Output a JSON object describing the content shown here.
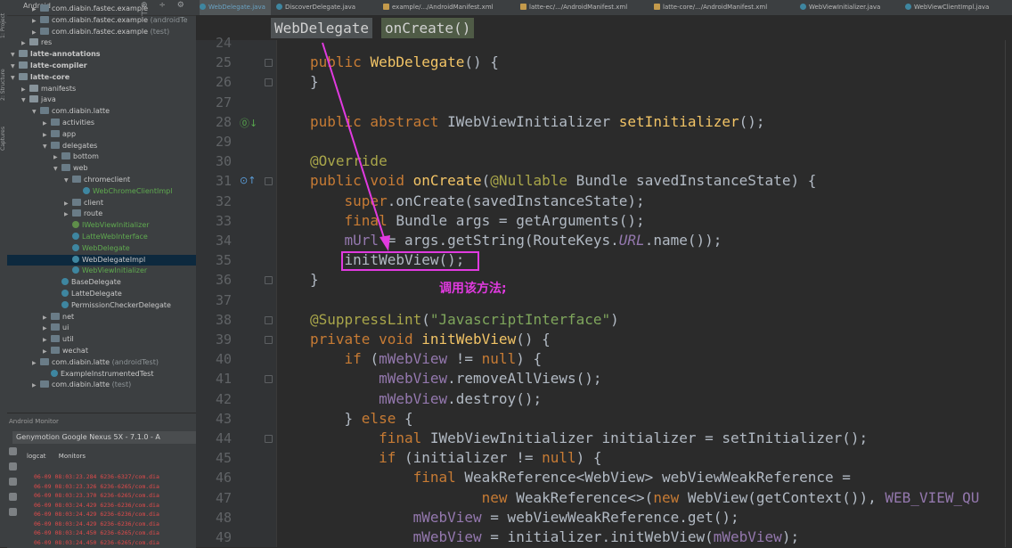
{
  "colors": {
    "accent": "#e13ae0",
    "editor_bg": "#2b2b2b",
    "panel_bg": "#3c3f41",
    "keyword": "#c77b34"
  },
  "side_strip": [
    "1: Project",
    "2: Structure",
    "Captures"
  ],
  "project_panel": {
    "selector": "Android",
    "items": [
      {
        "indent": 2,
        "icon": "pkg",
        "label": "com.diabin.fastec.example",
        "suffix": ""
      },
      {
        "indent": 2,
        "icon": "pkg",
        "label": "com.diabin.fastec.example",
        "suffix": " (androidTe"
      },
      {
        "indent": 2,
        "icon": "pkg",
        "label": "com.diabin.fastec.example",
        "suffix": " (test)"
      },
      {
        "indent": 1,
        "icon": "folder",
        "label": "res",
        "suffix": ""
      },
      {
        "indent": 0,
        "icon": "mod",
        "label": "latte-annotations",
        "suffix": ""
      },
      {
        "indent": 0,
        "icon": "mod",
        "label": "latte-compiler",
        "suffix": ""
      },
      {
        "indent": 0,
        "icon": "mod",
        "label": "latte-core",
        "suffix": ""
      },
      {
        "indent": 1,
        "icon": "folder",
        "label": "manifests",
        "suffix": ""
      },
      {
        "indent": 1,
        "icon": "folder",
        "label": "java",
        "suffix": ""
      },
      {
        "indent": 2,
        "icon": "pkg",
        "label": "com.diabin.latte",
        "suffix": ""
      },
      {
        "indent": 3,
        "icon": "pkg",
        "label": "activities",
        "suffix": ""
      },
      {
        "indent": 3,
        "icon": "pkg",
        "label": "app",
        "suffix": ""
      },
      {
        "indent": 3,
        "icon": "pkg",
        "label": "delegates",
        "suffix": ""
      },
      {
        "indent": 4,
        "icon": "pkg",
        "label": "bottom",
        "suffix": ""
      },
      {
        "indent": 4,
        "icon": "pkg",
        "label": "web",
        "suffix": ""
      },
      {
        "indent": 5,
        "icon": "pkg",
        "label": "chromeclient",
        "suffix": ""
      },
      {
        "indent": 6,
        "icon": "cls-green",
        "label": "WebChromeClientImpl",
        "suffix": ""
      },
      {
        "indent": 5,
        "icon": "pkg",
        "label": "client",
        "suffix": ""
      },
      {
        "indent": 5,
        "icon": "pkg",
        "label": "route",
        "suffix": ""
      },
      {
        "indent": 5,
        "icon": "iface-green",
        "label": "IWebViewInitializer",
        "suffix": ""
      },
      {
        "indent": 5,
        "icon": "cls-green",
        "label": "LatteWebInterface",
        "suffix": ""
      },
      {
        "indent": 5,
        "icon": "cls-green",
        "label": "WebDelegate",
        "suffix": ""
      },
      {
        "indent": 5,
        "icon": "cls",
        "label": "WebDelegateImpl",
        "suffix": ""
      },
      {
        "indent": 5,
        "icon": "cls-green",
        "label": "WebViewInitializer",
        "suffix": ""
      },
      {
        "indent": 4,
        "icon": "cls",
        "label": "BaseDelegate",
        "suffix": ""
      },
      {
        "indent": 4,
        "icon": "cls",
        "label": "LatteDelegate",
        "suffix": ""
      },
      {
        "indent": 4,
        "icon": "cls",
        "label": "PermissionCheckerDelegate",
        "suffix": ""
      },
      {
        "indent": 3,
        "icon": "pkg",
        "label": "net",
        "suffix": ""
      },
      {
        "indent": 3,
        "icon": "pkg",
        "label": "ui",
        "suffix": ""
      },
      {
        "indent": 3,
        "icon": "pkg",
        "label": "util",
        "suffix": ""
      },
      {
        "indent": 3,
        "icon": "pkg",
        "label": "wechat",
        "suffix": ""
      },
      {
        "indent": 2,
        "icon": "pkg",
        "label": "com.diabin.latte",
        "suffix": " (androidTest)"
      },
      {
        "indent": 3,
        "icon": "cls",
        "label": "ExampleInstrumentedTest",
        "suffix": ""
      },
      {
        "indent": 2,
        "icon": "pkg",
        "label": "com.diabin.latte",
        "suffix": " (test)"
      }
    ]
  },
  "android_monitor": {
    "title": "Android Monitor",
    "device": "Genymotion Google Nexus 5X - 7.1.0 - A",
    "tabs": [
      "logcat",
      "Monitors"
    ],
    "log_lines": [
      "06-09 08:03:23.284 6236-6327/com.dia",
      "06-09 08:03:23.326 6236-6265/com.dia",
      "06-09 08:03:23.370 6236-6265/com.dia",
      "06-09 08:03:24.429 6236-6236/com.dia",
      "06-09 08:03:24.429 6236-6236/com.dia",
      "06-09 08:03:24.429 6236-6236/com.dia",
      "06-09 08:03:24.450 6236-6265/com.dia",
      "06-09 08:03:24.450 6236-6265/com.dia",
      "06-09 08:03:24.699 6236-6241/com.dia"
    ]
  },
  "editor_tabs": [
    "WebDelegate.java",
    "DiscoverDelegate.java",
    "example/.../AndroidManifest.xml",
    "latte-ec/.../AndroidManifest.xml",
    "latte-core/.../AndroidManifest.xml",
    "WebViewInitializer.java",
    "WebViewClientImpl.java"
  ],
  "breadcrumb": [
    "WebDelegate",
    "onCreate()"
  ],
  "line_numbers": [
    "24",
    "25",
    "26",
    "27",
    "28",
    "29",
    "30",
    "31",
    "32",
    "33",
    "34",
    "35",
    "36",
    "37",
    "38",
    "39",
    "40",
    "41",
    "42",
    "43",
    "44",
    "45",
    "46",
    "47",
    "48",
    "49"
  ],
  "code_lines": [
    [],
    [
      [
        "kw",
        "public "
      ],
      [
        "fn",
        "WebDelegate"
      ],
      [
        "p",
        "() {"
      ]
    ],
    [
      [
        "p",
        "}"
      ]
    ],
    [],
    [
      [
        "kw",
        "public abstract "
      ],
      [
        "p",
        "IWebViewInitializer "
      ],
      [
        "fn",
        "setInitializer"
      ],
      [
        "p",
        "();"
      ]
    ],
    [],
    [
      [
        "an",
        "@Override"
      ]
    ],
    [
      [
        "kw",
        "public void "
      ],
      [
        "fn",
        "onCreate"
      ],
      [
        "p",
        "("
      ],
      [
        "an",
        "@Nullable "
      ],
      [
        "p",
        "Bundle savedInstanceState) {"
      ]
    ],
    [
      [
        "p",
        "    "
      ],
      [
        "kw",
        "super"
      ],
      [
        "p",
        ".onCreate(savedInstanceState);"
      ]
    ],
    [
      [
        "p",
        "    "
      ],
      [
        "kw",
        "final "
      ],
      [
        "p",
        "Bundle args = getArguments();"
      ]
    ],
    [
      [
        "p",
        "    "
      ],
      [
        "pr",
        "mUrl"
      ],
      [
        "p",
        " = args.getString(RouteKeys."
      ],
      [
        "it",
        "URL"
      ],
      [
        "p",
        ".name());"
      ]
    ],
    [
      [
        "p",
        "    initWebView();"
      ]
    ],
    [
      [
        "p",
        "}"
      ]
    ],
    [],
    [
      [
        "an",
        "@SuppressLint"
      ],
      [
        "p",
        "("
      ],
      [
        "st",
        "\"JavascriptInterface\""
      ],
      [
        "p",
        ")"
      ]
    ],
    [
      [
        "kw",
        "private void "
      ],
      [
        "fn",
        "initWebView"
      ],
      [
        "p",
        "() {"
      ]
    ],
    [
      [
        "p",
        "    "
      ],
      [
        "kw",
        "if "
      ],
      [
        "p",
        "("
      ],
      [
        "pr",
        "mWebView"
      ],
      [
        "p",
        " != "
      ],
      [
        "kw",
        "null"
      ],
      [
        "p",
        ") {"
      ]
    ],
    [
      [
        "p",
        "        "
      ],
      [
        "pr",
        "mWebView"
      ],
      [
        "p",
        ".removeAllViews();"
      ]
    ],
    [
      [
        "p",
        "        "
      ],
      [
        "pr",
        "mWebView"
      ],
      [
        "p",
        ".destroy();"
      ]
    ],
    [
      [
        "p",
        "    } "
      ],
      [
        "kw",
        "else "
      ],
      [
        "p",
        "{"
      ]
    ],
    [
      [
        "p",
        "        "
      ],
      [
        "kw",
        "final "
      ],
      [
        "p",
        "IWebViewInitializer initializer = setInitializer();"
      ]
    ],
    [
      [
        "p",
        "        "
      ],
      [
        "kw",
        "if "
      ],
      [
        "p",
        "(initializer != "
      ],
      [
        "kw",
        "null"
      ],
      [
        "p",
        ") {"
      ]
    ],
    [
      [
        "p",
        "            "
      ],
      [
        "kw",
        "final "
      ],
      [
        "p",
        "WeakReference<WebView> webViewWeakReference ="
      ]
    ],
    [
      [
        "p",
        "                    "
      ],
      [
        "kw",
        "new "
      ],
      [
        "p",
        "WeakReference<>("
      ],
      [
        "kw",
        "new "
      ],
      [
        "p",
        "WebView(getContext()), "
      ],
      [
        "pr",
        "WEB_VIEW_QU"
      ]
    ],
    [
      [
        "p",
        "            "
      ],
      [
        "pr",
        "mWebView"
      ],
      [
        "p",
        " = webViewWeakReference.get();"
      ]
    ],
    [
      [
        "p",
        "            "
      ],
      [
        "pr",
        "mWebView"
      ],
      [
        "p",
        " = initializer.initWebView("
      ],
      [
        "pr",
        "mWebView"
      ],
      [
        "p",
        ");"
      ]
    ]
  ],
  "annotation": {
    "note": "调用该方法;"
  }
}
